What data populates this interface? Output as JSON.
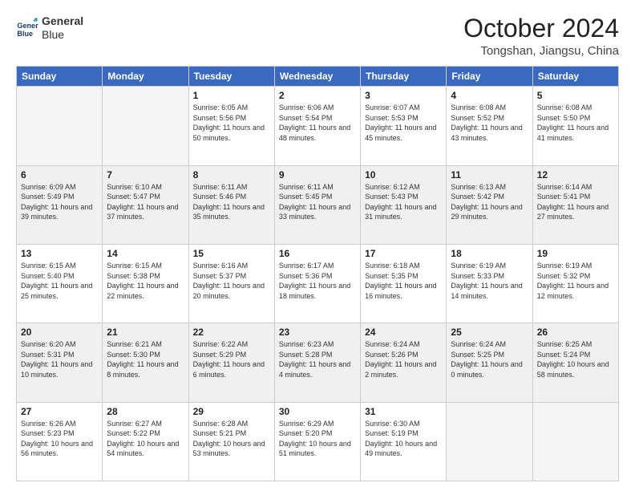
{
  "header": {
    "logo": {
      "line1": "General",
      "line2": "Blue"
    },
    "title": "October 2024",
    "subtitle": "Tongshan, Jiangsu, China"
  },
  "days_of_week": [
    "Sunday",
    "Monday",
    "Tuesday",
    "Wednesday",
    "Thursday",
    "Friday",
    "Saturday"
  ],
  "weeks": [
    [
      {
        "day": "",
        "empty": true
      },
      {
        "day": "",
        "empty": true
      },
      {
        "day": "1",
        "sunrise": "6:05 AM",
        "sunset": "5:56 PM",
        "daylight": "11 hours and 50 minutes."
      },
      {
        "day": "2",
        "sunrise": "6:06 AM",
        "sunset": "5:54 PM",
        "daylight": "11 hours and 48 minutes."
      },
      {
        "day": "3",
        "sunrise": "6:07 AM",
        "sunset": "5:53 PM",
        "daylight": "11 hours and 45 minutes."
      },
      {
        "day": "4",
        "sunrise": "6:08 AM",
        "sunset": "5:52 PM",
        "daylight": "11 hours and 43 minutes."
      },
      {
        "day": "5",
        "sunrise": "6:08 AM",
        "sunset": "5:50 PM",
        "daylight": "11 hours and 41 minutes."
      }
    ],
    [
      {
        "day": "6",
        "sunrise": "6:09 AM",
        "sunset": "5:49 PM",
        "daylight": "11 hours and 39 minutes."
      },
      {
        "day": "7",
        "sunrise": "6:10 AM",
        "sunset": "5:47 PM",
        "daylight": "11 hours and 37 minutes."
      },
      {
        "day": "8",
        "sunrise": "6:11 AM",
        "sunset": "5:46 PM",
        "daylight": "11 hours and 35 minutes."
      },
      {
        "day": "9",
        "sunrise": "6:11 AM",
        "sunset": "5:45 PM",
        "daylight": "11 hours and 33 minutes."
      },
      {
        "day": "10",
        "sunrise": "6:12 AM",
        "sunset": "5:43 PM",
        "daylight": "11 hours and 31 minutes."
      },
      {
        "day": "11",
        "sunrise": "6:13 AM",
        "sunset": "5:42 PM",
        "daylight": "11 hours and 29 minutes."
      },
      {
        "day": "12",
        "sunrise": "6:14 AM",
        "sunset": "5:41 PM",
        "daylight": "11 hours and 27 minutes."
      }
    ],
    [
      {
        "day": "13",
        "sunrise": "6:15 AM",
        "sunset": "5:40 PM",
        "daylight": "11 hours and 25 minutes."
      },
      {
        "day": "14",
        "sunrise": "6:15 AM",
        "sunset": "5:38 PM",
        "daylight": "11 hours and 22 minutes."
      },
      {
        "day": "15",
        "sunrise": "6:16 AM",
        "sunset": "5:37 PM",
        "daylight": "11 hours and 20 minutes."
      },
      {
        "day": "16",
        "sunrise": "6:17 AM",
        "sunset": "5:36 PM",
        "daylight": "11 hours and 18 minutes."
      },
      {
        "day": "17",
        "sunrise": "6:18 AM",
        "sunset": "5:35 PM",
        "daylight": "11 hours and 16 minutes."
      },
      {
        "day": "18",
        "sunrise": "6:19 AM",
        "sunset": "5:33 PM",
        "daylight": "11 hours and 14 minutes."
      },
      {
        "day": "19",
        "sunrise": "6:19 AM",
        "sunset": "5:32 PM",
        "daylight": "11 hours and 12 minutes."
      }
    ],
    [
      {
        "day": "20",
        "sunrise": "6:20 AM",
        "sunset": "5:31 PM",
        "daylight": "11 hours and 10 minutes."
      },
      {
        "day": "21",
        "sunrise": "6:21 AM",
        "sunset": "5:30 PM",
        "daylight": "11 hours and 8 minutes."
      },
      {
        "day": "22",
        "sunrise": "6:22 AM",
        "sunset": "5:29 PM",
        "daylight": "11 hours and 6 minutes."
      },
      {
        "day": "23",
        "sunrise": "6:23 AM",
        "sunset": "5:28 PM",
        "daylight": "11 hours and 4 minutes."
      },
      {
        "day": "24",
        "sunrise": "6:24 AM",
        "sunset": "5:26 PM",
        "daylight": "11 hours and 2 minutes."
      },
      {
        "day": "25",
        "sunrise": "6:24 AM",
        "sunset": "5:25 PM",
        "daylight": "11 hours and 0 minutes."
      },
      {
        "day": "26",
        "sunrise": "6:25 AM",
        "sunset": "5:24 PM",
        "daylight": "10 hours and 58 minutes."
      }
    ],
    [
      {
        "day": "27",
        "sunrise": "6:26 AM",
        "sunset": "5:23 PM",
        "daylight": "10 hours and 56 minutes."
      },
      {
        "day": "28",
        "sunrise": "6:27 AM",
        "sunset": "5:22 PM",
        "daylight": "10 hours and 54 minutes."
      },
      {
        "day": "29",
        "sunrise": "6:28 AM",
        "sunset": "5:21 PM",
        "daylight": "10 hours and 53 minutes."
      },
      {
        "day": "30",
        "sunrise": "6:29 AM",
        "sunset": "5:20 PM",
        "daylight": "10 hours and 51 minutes."
      },
      {
        "day": "31",
        "sunrise": "6:30 AM",
        "sunset": "5:19 PM",
        "daylight": "10 hours and 49 minutes."
      },
      {
        "day": "",
        "empty": true
      },
      {
        "day": "",
        "empty": true
      }
    ]
  ]
}
